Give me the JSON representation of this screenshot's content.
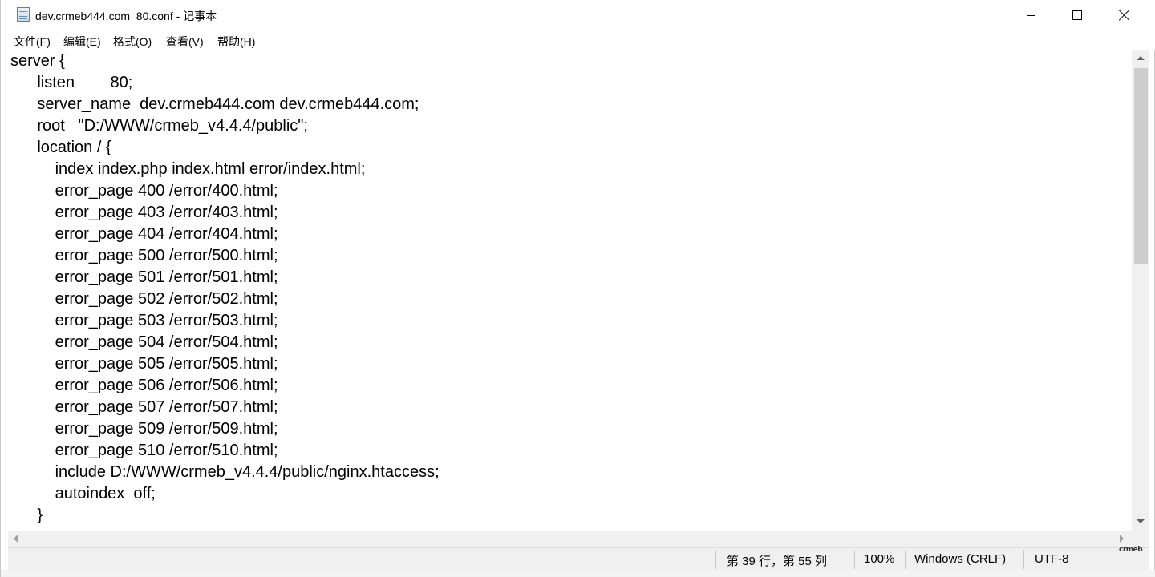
{
  "window": {
    "title": "dev.crmeb444.com_80.conf - 记事本",
    "icon": "notepad-icon"
  },
  "menu": [
    {
      "label": "文件(F)"
    },
    {
      "label": "编辑(E)"
    },
    {
      "label": "格式(O)"
    },
    {
      "label": "查看(V)"
    },
    {
      "label": "帮助(H)"
    }
  ],
  "editor": {
    "lines": [
      "server {",
      "\tlisten        80;",
      "\tserver_name  dev.crmeb444.com dev.crmeb444.com;",
      "\troot   \"D:/WWW/crmeb_v4.4.4/public\";",
      "\tlocation / {",
      "\t    index index.php index.html error/index.html;",
      "\t    error_page 400 /error/400.html;",
      "\t    error_page 403 /error/403.html;",
      "\t    error_page 404 /error/404.html;",
      "\t    error_page 500 /error/500.html;",
      "\t    error_page 501 /error/501.html;",
      "\t    error_page 502 /error/502.html;",
      "\t    error_page 503 /error/503.html;",
      "\t    error_page 504 /error/504.html;",
      "\t    error_page 505 /error/505.html;",
      "\t    error_page 506 /error/506.html;",
      "\t    error_page 507 /error/507.html;",
      "\t    error_page 509 /error/509.html;",
      "\t    error_page 510 /error/510.html;",
      "\t    include D:/WWW/crmeb_v4.4.4/public/nginx.htaccess;",
      "\t    autoindex  off;",
      "\t}"
    ]
  },
  "status": {
    "position": "第 39 行，第 55 列",
    "zoom": "100%",
    "line_ending": "Windows (CRLF)",
    "encoding": "UTF-8"
  },
  "watermark": "crmeb"
}
